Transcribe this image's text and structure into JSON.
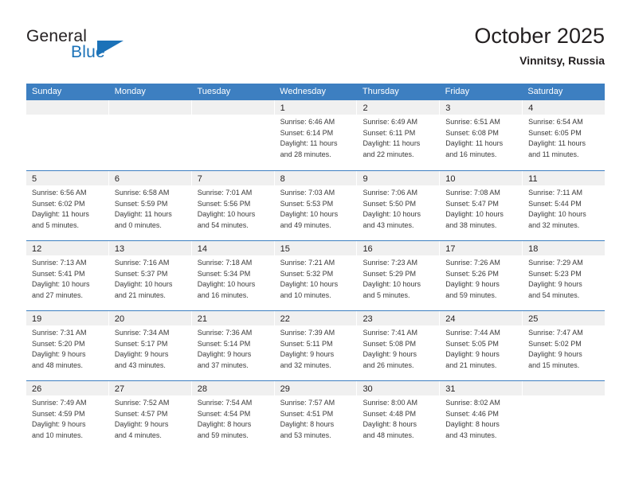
{
  "brand": {
    "name_part1": "General",
    "name_part2": "Blue",
    "accent_color": "#1b72b8"
  },
  "header": {
    "title": "October 2025",
    "subtitle": "Vinnitsy, Russia"
  },
  "theme": {
    "header_row_bg": "#3d7fc1",
    "day_band_bg": "#f0f0f0",
    "text_color": "#231f20"
  },
  "weekdays": [
    "Sunday",
    "Monday",
    "Tuesday",
    "Wednesday",
    "Thursday",
    "Friday",
    "Saturday"
  ],
  "weeks": [
    [
      {
        "day": "",
        "sunrise": "",
        "sunset": "",
        "daylight_line1": "",
        "daylight_line2": ""
      },
      {
        "day": "",
        "sunrise": "",
        "sunset": "",
        "daylight_line1": "",
        "daylight_line2": ""
      },
      {
        "day": "",
        "sunrise": "",
        "sunset": "",
        "daylight_line1": "",
        "daylight_line2": ""
      },
      {
        "day": "1",
        "sunrise": "Sunrise: 6:46 AM",
        "sunset": "Sunset: 6:14 PM",
        "daylight_line1": "Daylight: 11 hours",
        "daylight_line2": "and 28 minutes."
      },
      {
        "day": "2",
        "sunrise": "Sunrise: 6:49 AM",
        "sunset": "Sunset: 6:11 PM",
        "daylight_line1": "Daylight: 11 hours",
        "daylight_line2": "and 22 minutes."
      },
      {
        "day": "3",
        "sunrise": "Sunrise: 6:51 AM",
        "sunset": "Sunset: 6:08 PM",
        "daylight_line1": "Daylight: 11 hours",
        "daylight_line2": "and 16 minutes."
      },
      {
        "day": "4",
        "sunrise": "Sunrise: 6:54 AM",
        "sunset": "Sunset: 6:05 PM",
        "daylight_line1": "Daylight: 11 hours",
        "daylight_line2": "and 11 minutes."
      }
    ],
    [
      {
        "day": "5",
        "sunrise": "Sunrise: 6:56 AM",
        "sunset": "Sunset: 6:02 PM",
        "daylight_line1": "Daylight: 11 hours",
        "daylight_line2": "and 5 minutes."
      },
      {
        "day": "6",
        "sunrise": "Sunrise: 6:58 AM",
        "sunset": "Sunset: 5:59 PM",
        "daylight_line1": "Daylight: 11 hours",
        "daylight_line2": "and 0 minutes."
      },
      {
        "day": "7",
        "sunrise": "Sunrise: 7:01 AM",
        "sunset": "Sunset: 5:56 PM",
        "daylight_line1": "Daylight: 10 hours",
        "daylight_line2": "and 54 minutes."
      },
      {
        "day": "8",
        "sunrise": "Sunrise: 7:03 AM",
        "sunset": "Sunset: 5:53 PM",
        "daylight_line1": "Daylight: 10 hours",
        "daylight_line2": "and 49 minutes."
      },
      {
        "day": "9",
        "sunrise": "Sunrise: 7:06 AM",
        "sunset": "Sunset: 5:50 PM",
        "daylight_line1": "Daylight: 10 hours",
        "daylight_line2": "and 43 minutes."
      },
      {
        "day": "10",
        "sunrise": "Sunrise: 7:08 AM",
        "sunset": "Sunset: 5:47 PM",
        "daylight_line1": "Daylight: 10 hours",
        "daylight_line2": "and 38 minutes."
      },
      {
        "day": "11",
        "sunrise": "Sunrise: 7:11 AM",
        "sunset": "Sunset: 5:44 PM",
        "daylight_line1": "Daylight: 10 hours",
        "daylight_line2": "and 32 minutes."
      }
    ],
    [
      {
        "day": "12",
        "sunrise": "Sunrise: 7:13 AM",
        "sunset": "Sunset: 5:41 PM",
        "daylight_line1": "Daylight: 10 hours",
        "daylight_line2": "and 27 minutes."
      },
      {
        "day": "13",
        "sunrise": "Sunrise: 7:16 AM",
        "sunset": "Sunset: 5:37 PM",
        "daylight_line1": "Daylight: 10 hours",
        "daylight_line2": "and 21 minutes."
      },
      {
        "day": "14",
        "sunrise": "Sunrise: 7:18 AM",
        "sunset": "Sunset: 5:34 PM",
        "daylight_line1": "Daylight: 10 hours",
        "daylight_line2": "and 16 minutes."
      },
      {
        "day": "15",
        "sunrise": "Sunrise: 7:21 AM",
        "sunset": "Sunset: 5:32 PM",
        "daylight_line1": "Daylight: 10 hours",
        "daylight_line2": "and 10 minutes."
      },
      {
        "day": "16",
        "sunrise": "Sunrise: 7:23 AM",
        "sunset": "Sunset: 5:29 PM",
        "daylight_line1": "Daylight: 10 hours",
        "daylight_line2": "and 5 minutes."
      },
      {
        "day": "17",
        "sunrise": "Sunrise: 7:26 AM",
        "sunset": "Sunset: 5:26 PM",
        "daylight_line1": "Daylight: 9 hours",
        "daylight_line2": "and 59 minutes."
      },
      {
        "day": "18",
        "sunrise": "Sunrise: 7:29 AM",
        "sunset": "Sunset: 5:23 PM",
        "daylight_line1": "Daylight: 9 hours",
        "daylight_line2": "and 54 minutes."
      }
    ],
    [
      {
        "day": "19",
        "sunrise": "Sunrise: 7:31 AM",
        "sunset": "Sunset: 5:20 PM",
        "daylight_line1": "Daylight: 9 hours",
        "daylight_line2": "and 48 minutes."
      },
      {
        "day": "20",
        "sunrise": "Sunrise: 7:34 AM",
        "sunset": "Sunset: 5:17 PM",
        "daylight_line1": "Daylight: 9 hours",
        "daylight_line2": "and 43 minutes."
      },
      {
        "day": "21",
        "sunrise": "Sunrise: 7:36 AM",
        "sunset": "Sunset: 5:14 PM",
        "daylight_line1": "Daylight: 9 hours",
        "daylight_line2": "and 37 minutes."
      },
      {
        "day": "22",
        "sunrise": "Sunrise: 7:39 AM",
        "sunset": "Sunset: 5:11 PM",
        "daylight_line1": "Daylight: 9 hours",
        "daylight_line2": "and 32 minutes."
      },
      {
        "day": "23",
        "sunrise": "Sunrise: 7:41 AM",
        "sunset": "Sunset: 5:08 PM",
        "daylight_line1": "Daylight: 9 hours",
        "daylight_line2": "and 26 minutes."
      },
      {
        "day": "24",
        "sunrise": "Sunrise: 7:44 AM",
        "sunset": "Sunset: 5:05 PM",
        "daylight_line1": "Daylight: 9 hours",
        "daylight_line2": "and 21 minutes."
      },
      {
        "day": "25",
        "sunrise": "Sunrise: 7:47 AM",
        "sunset": "Sunset: 5:02 PM",
        "daylight_line1": "Daylight: 9 hours",
        "daylight_line2": "and 15 minutes."
      }
    ],
    [
      {
        "day": "26",
        "sunrise": "Sunrise: 7:49 AM",
        "sunset": "Sunset: 4:59 PM",
        "daylight_line1": "Daylight: 9 hours",
        "daylight_line2": "and 10 minutes."
      },
      {
        "day": "27",
        "sunrise": "Sunrise: 7:52 AM",
        "sunset": "Sunset: 4:57 PM",
        "daylight_line1": "Daylight: 9 hours",
        "daylight_line2": "and 4 minutes."
      },
      {
        "day": "28",
        "sunrise": "Sunrise: 7:54 AM",
        "sunset": "Sunset: 4:54 PM",
        "daylight_line1": "Daylight: 8 hours",
        "daylight_line2": "and 59 minutes."
      },
      {
        "day": "29",
        "sunrise": "Sunrise: 7:57 AM",
        "sunset": "Sunset: 4:51 PM",
        "daylight_line1": "Daylight: 8 hours",
        "daylight_line2": "and 53 minutes."
      },
      {
        "day": "30",
        "sunrise": "Sunrise: 8:00 AM",
        "sunset": "Sunset: 4:48 PM",
        "daylight_line1": "Daylight: 8 hours",
        "daylight_line2": "and 48 minutes."
      },
      {
        "day": "31",
        "sunrise": "Sunrise: 8:02 AM",
        "sunset": "Sunset: 4:46 PM",
        "daylight_line1": "Daylight: 8 hours",
        "daylight_line2": "and 43 minutes."
      },
      {
        "day": "",
        "sunrise": "",
        "sunset": "",
        "daylight_line1": "",
        "daylight_line2": ""
      }
    ]
  ]
}
